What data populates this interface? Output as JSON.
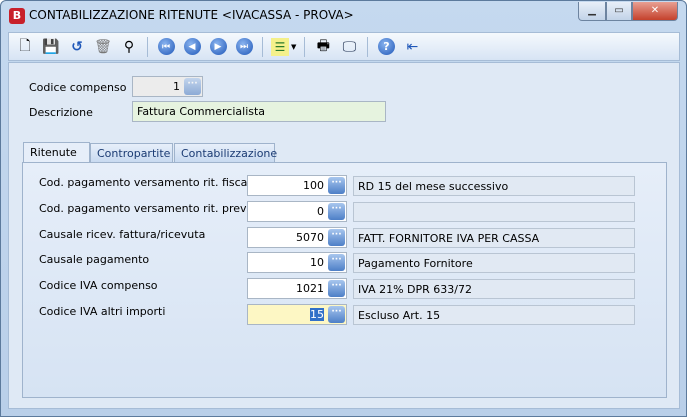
{
  "window": {
    "title": "CONTABILIZZAZIONE RITENUTE <IVACASSA - PROVA>",
    "app_icon": "B",
    "controls": [
      "minimize",
      "maximize",
      "close"
    ]
  },
  "toolbar": {
    "icons": [
      "new-icon",
      "save-icon",
      "undo-icon",
      "delete-icon",
      "search-icon",
      "first-icon",
      "previous-icon",
      "next-icon",
      "last-icon",
      "list-icon",
      "print-icon",
      "preview-icon",
      "help-icon",
      "exit-icon"
    ]
  },
  "header": {
    "codice_label": "Codice compenso",
    "codice_value": "1",
    "descrizione_label": "Descrizione",
    "descrizione_value": "Fattura Commercialista"
  },
  "tabs": [
    {
      "label": "Ritenute"
    },
    {
      "label": "Contropartite"
    },
    {
      "label": "Contabilizzazione"
    }
  ],
  "rows": [
    {
      "label": "Cod. pagamento versamento rit. fiscale",
      "code": "100",
      "desc": "RD 15 del mese successivo"
    },
    {
      "label": "Cod. pagamento versamento rit. previd.",
      "code": "0",
      "desc": ""
    },
    {
      "label": "Causale ricev. fattura/ricevuta",
      "code": "5070",
      "desc": "FATT. FORNITORE IVA PER CASSA"
    },
    {
      "label": "Causale pagamento",
      "code": "10",
      "desc": "Pagamento Fornitore"
    },
    {
      "label": "Codice IVA compenso",
      "code": "1021",
      "desc": "IVA 21% DPR 633/72"
    },
    {
      "label": "Codice IVA altri importi",
      "code": "15",
      "desc": "Escluso Art. 15"
    }
  ]
}
